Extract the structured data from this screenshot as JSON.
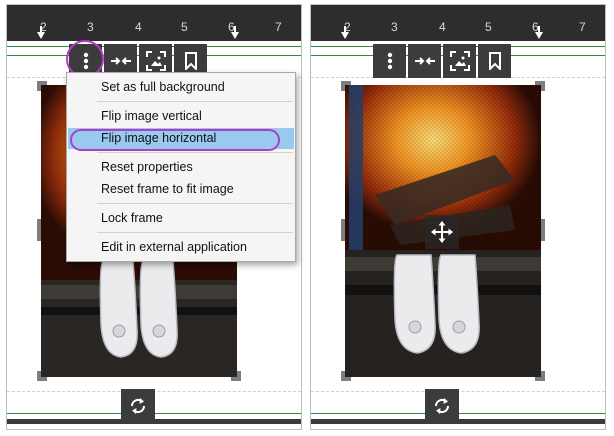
{
  "rulers": {
    "left": [
      "2",
      "3",
      "4",
      "5",
      "6",
      "7"
    ],
    "right": [
      "2",
      "3",
      "4",
      "5",
      "6",
      "7"
    ]
  },
  "toolbar": {
    "icons": [
      "more-vertical-icon",
      "fit-arrows-icon",
      "image-frame-icon",
      "bookmark-icon"
    ]
  },
  "context_menu": {
    "items": [
      {
        "label": "Set as full background"
      },
      {
        "label": "Flip image vertical"
      },
      {
        "label": "Flip image horizontal",
        "selected": true
      },
      {
        "label": "Reset properties"
      },
      {
        "label": "Reset frame to fit image"
      },
      {
        "label": "Lock frame"
      },
      {
        "label": "Edit in external application"
      }
    ]
  },
  "colors": {
    "highlight": "#b03ec4",
    "selected_item": "#99c9ef",
    "toolbar_bg": "#3c3c3c",
    "ruler_bg": "#2d2d2d",
    "guide_green": "#2e8b3e"
  }
}
